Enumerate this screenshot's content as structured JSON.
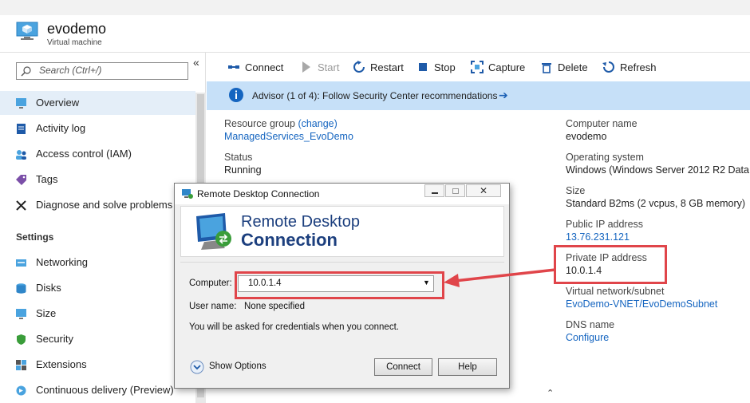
{
  "header": {
    "title": "evodemo",
    "subtitle": "Virtual machine"
  },
  "sidebar": {
    "search_placeholder": "Search (Ctrl+/)",
    "collapse_glyph": "«",
    "items": [
      {
        "label": "Overview",
        "icon": "overview-icon",
        "selected": true
      },
      {
        "label": "Activity log",
        "icon": "activity-log-icon"
      },
      {
        "label": "Access control (IAM)",
        "icon": "iam-icon"
      },
      {
        "label": "Tags",
        "icon": "tag-icon"
      },
      {
        "label": "Diagnose and solve problems",
        "icon": "wrench-icon"
      }
    ],
    "settings_header": "Settings",
    "settings_items": [
      {
        "label": "Networking",
        "icon": "network-icon"
      },
      {
        "label": "Disks",
        "icon": "disk-icon"
      },
      {
        "label": "Size",
        "icon": "size-icon"
      },
      {
        "label": "Security",
        "icon": "shield-icon"
      },
      {
        "label": "Extensions",
        "icon": "extensions-icon"
      },
      {
        "label": "Continuous delivery (Preview)",
        "icon": "delivery-icon"
      }
    ]
  },
  "toolbar": {
    "connect": "Connect",
    "start": "Start",
    "restart": "Restart",
    "stop": "Stop",
    "capture": "Capture",
    "delete": "Delete",
    "refresh": "Refresh"
  },
  "advisor": {
    "text": "Advisor (1 of 4): Follow Security Center recommendations",
    "arrow": "➔"
  },
  "essentials": {
    "resource_group_label": "Resource group",
    "resource_group_change": "(change)",
    "resource_group_value": "ManagedServices_EvoDemo",
    "status_label": "Status",
    "status_value": "Running",
    "computer_name_label": "Computer name",
    "computer_name_value": "evodemo",
    "os_label": "Operating system",
    "os_value": "Windows (Windows Server 2012 R2 Data",
    "size_label": "Size",
    "size_value": "Standard B2ms (2 vcpus, 8 GB memory)",
    "public_ip_label": "Public IP address",
    "public_ip_value": "13.76.231.121",
    "private_ip_label": "Private IP address",
    "private_ip_value": "10.0.1.4",
    "vnet_label": "Virtual network/subnet",
    "vnet_value": "EvoDemo-VNET/EvoDemoSubnet",
    "dns_label": "DNS name",
    "dns_value": "Configure"
  },
  "rdp": {
    "title": "Remote Desktop Connection",
    "banner_line1": "Remote Desktop",
    "banner_line2": "Connection",
    "computer_label": "Computer:",
    "computer_value": "10.0.1.4",
    "username_label": "User name:",
    "username_value": "None specified",
    "credentials_note": "You will be asked for credentials when you connect.",
    "show_options": "Show Options",
    "connect_button": "Connect",
    "help_button": "Help"
  },
  "colors": {
    "highlight": "#e0454a",
    "link": "#1565c0",
    "advisor_bg": "#c6e0f8",
    "selected_nav": "#e4eef8"
  }
}
